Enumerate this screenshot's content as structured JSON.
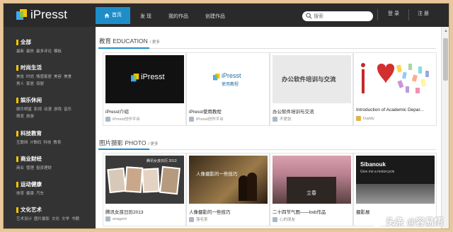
{
  "app": {
    "name": "iPresst"
  },
  "nav": {
    "items": [
      {
        "label": "首页",
        "active": true
      },
      {
        "label": "发 现"
      },
      {
        "label": "我的作品"
      },
      {
        "label": "创建作品"
      }
    ],
    "search_placeholder": "搜索",
    "login": "登 录",
    "register": "注 册"
  },
  "sidebar": {
    "categories": [
      {
        "title": "全部",
        "color": "#f5c400",
        "links": [
          "最新",
          "最热",
          "最多评论",
          "模板"
        ]
      },
      {
        "title": "时尚生活",
        "color": "#f5c400",
        "links": [
          "美妆",
          "时尚",
          "情感家居",
          "美容",
          "美食",
          "男人",
          "家居",
          "母婴"
        ]
      },
      {
        "title": "娱乐休闲",
        "color": "#f5c400",
        "links": [
          "娱乐明星",
          "影视",
          "动漫",
          "游戏",
          "音乐",
          "萌宠",
          "旅游"
        ]
      },
      {
        "title": "科技教育",
        "color": "#f5c400",
        "links": [
          "互联网",
          "IT数码",
          "科技",
          "教育"
        ]
      },
      {
        "title": "商业财经",
        "color": "#f5c400",
        "links": [
          "商业",
          "管理",
          "投资理财"
        ]
      },
      {
        "title": "运动健康",
        "color": "#f5c400",
        "links": [
          "体育",
          "健康",
          "汽车"
        ]
      },
      {
        "title": "文化艺术",
        "color": "#f5c400",
        "links": [
          "艺术设计",
          "图片摄影",
          "文化",
          "文学",
          "书籍"
        ]
      }
    ]
  },
  "sections": [
    {
      "title": "教育 EDUCATION",
      "more": "/ 更多",
      "cards": [
        {
          "title": "iPresst介绍",
          "author": "iPresst创作平台",
          "thumb_text": "iPresst",
          "thumb_sub": ""
        },
        {
          "title": "iPresst使用教程",
          "author": "iPresst创作平台",
          "thumb_text": "iPresst",
          "thumb_sub": "使用教程"
        },
        {
          "title": "办公软件培训与交流",
          "author": "不爱张",
          "thumb_text": "办公软件培训与交流",
          "thumb_sub": ""
        },
        {
          "title": "Introduction of Academic Depar...",
          "author": "Daddy",
          "thumb_text": "",
          "thumb_sub": ""
        }
      ]
    },
    {
      "title": "图片摄影 PHOTO",
      "more": "/ 更多",
      "cards": [
        {
          "title": "腾讯女孩日历2013",
          "author": "enagent",
          "thumb_text": "腾讯女孩日历 2013",
          "thumb_sub": ""
        },
        {
          "title": "人像摄影的一些技巧",
          "author": "落毛茶",
          "thumb_text": "人像摄影的一些技巧",
          "thumb_sub": ""
        },
        {
          "title": "二十四节气图——bxb作品",
          "author": "心的朋友",
          "thumb_text": "立春",
          "thumb_sub": ""
        },
        {
          "title": "摄影展",
          "author": "",
          "thumb_text": "Sibanouk",
          "thumb_sub": "Give me a motorcycle"
        }
      ]
    }
  ],
  "watermark": "头条 @容易悟"
}
